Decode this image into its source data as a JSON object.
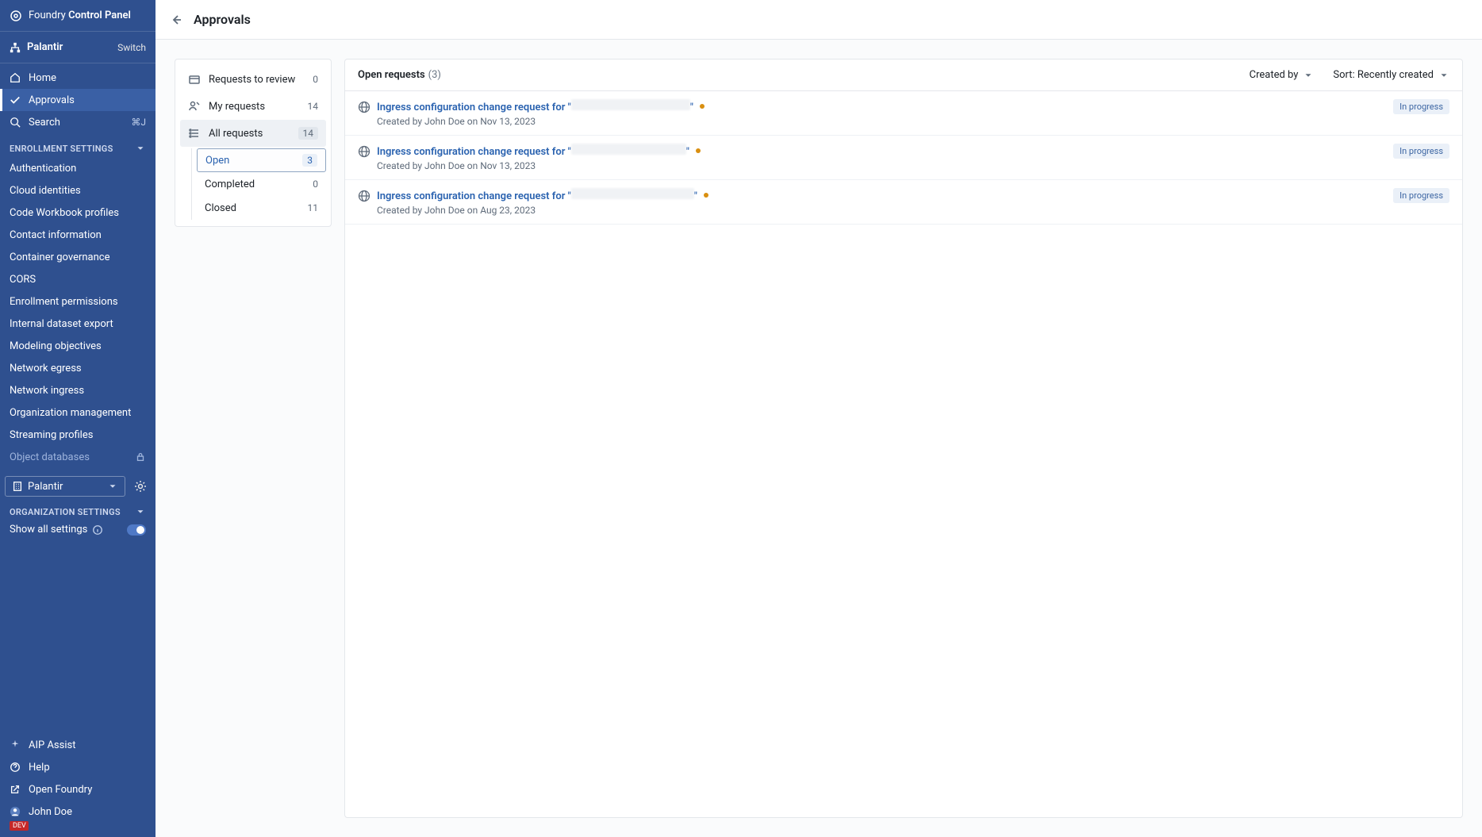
{
  "brand": {
    "name_light": "Foundry",
    "name_bold": "Control Panel"
  },
  "org_header": {
    "name": "Palantir",
    "switch_label": "Switch"
  },
  "nav": {
    "home": "Home",
    "approvals": "Approvals",
    "search": "Search",
    "search_shortcut": "⌘J"
  },
  "enrollment_section": {
    "title": "ENROLLMENT SETTINGS",
    "items": [
      "Authentication",
      "Cloud identities",
      "Code Workbook profiles",
      "Contact information",
      "Container governance",
      "CORS",
      "Enrollment permissions",
      "Internal dataset export",
      "Modeling objectives",
      "Network egress",
      "Network ingress",
      "Organization management",
      "Streaming profiles"
    ],
    "locked_item": "Object databases"
  },
  "org_picker": {
    "value": "Palantir"
  },
  "org_settings_header": "ORGANIZATION SETTINGS",
  "show_all_settings_label": "Show all settings",
  "bottom_links": {
    "aip": "AIP Assist",
    "help": "Help",
    "open_foundry": "Open Foundry",
    "user": "John Doe",
    "dev_badge": "DEV"
  },
  "page_title": "Approvals",
  "filter_panel": {
    "items": [
      {
        "label": "Requests to review",
        "count": "0"
      },
      {
        "label": "My requests",
        "count": "14"
      },
      {
        "label": "All requests",
        "count": "14",
        "active": true
      }
    ],
    "subs": [
      {
        "label": "Open",
        "count": "3",
        "selected": true
      },
      {
        "label": "Completed",
        "count": "0"
      },
      {
        "label": "Closed",
        "count": "11"
      }
    ]
  },
  "requests": {
    "header_title": "Open requests",
    "header_count": "(3)",
    "created_by_label": "Created by",
    "sort_label": "Sort: Recently created",
    "status_label": "In progress",
    "rows": [
      {
        "title_prefix": "Ingress configuration change request for \"",
        "title_suffix": "\"",
        "redact_w": 150,
        "created": "Created by John Doe on Nov 13, 2023"
      },
      {
        "title_prefix": "Ingress configuration change request for \"",
        "title_suffix": "\"",
        "redact_w": 145,
        "created": "Created by John Doe on Nov 13, 2023"
      },
      {
        "title_prefix": "Ingress configuration change request for \"",
        "title_suffix": "\"",
        "redact_w": 155,
        "created": "Created by John Doe on Aug 23, 2023"
      }
    ]
  }
}
